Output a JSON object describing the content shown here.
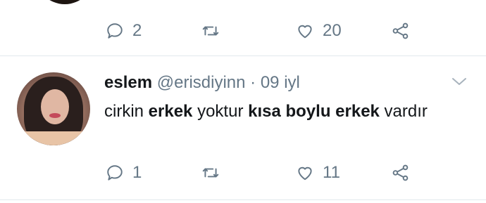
{
  "previous_tweet": {
    "actions": {
      "reply_count": "2",
      "retweet_count": "",
      "like_count": "20"
    }
  },
  "tweet": {
    "author_name": "eslem",
    "handle": "@erisdiyinn",
    "separator": "·",
    "time": "09 iyl",
    "text_parts": [
      {
        "text": "cirkin ",
        "bold": false
      },
      {
        "text": "erkek",
        "bold": true
      },
      {
        "text": " yoktur ",
        "bold": false
      },
      {
        "text": "kısa boylu erkek",
        "bold": true
      },
      {
        "text": " vardır",
        "bold": false
      }
    ],
    "actions": {
      "reply_count": "1",
      "retweet_count": "",
      "like_count": "11"
    }
  },
  "colors": {
    "icon": "#657786",
    "divider": "#e1e8ed",
    "text": "#14171a"
  },
  "icons": [
    "reply-icon",
    "retweet-icon",
    "like-icon",
    "share-icon",
    "chevron-down-icon"
  ]
}
